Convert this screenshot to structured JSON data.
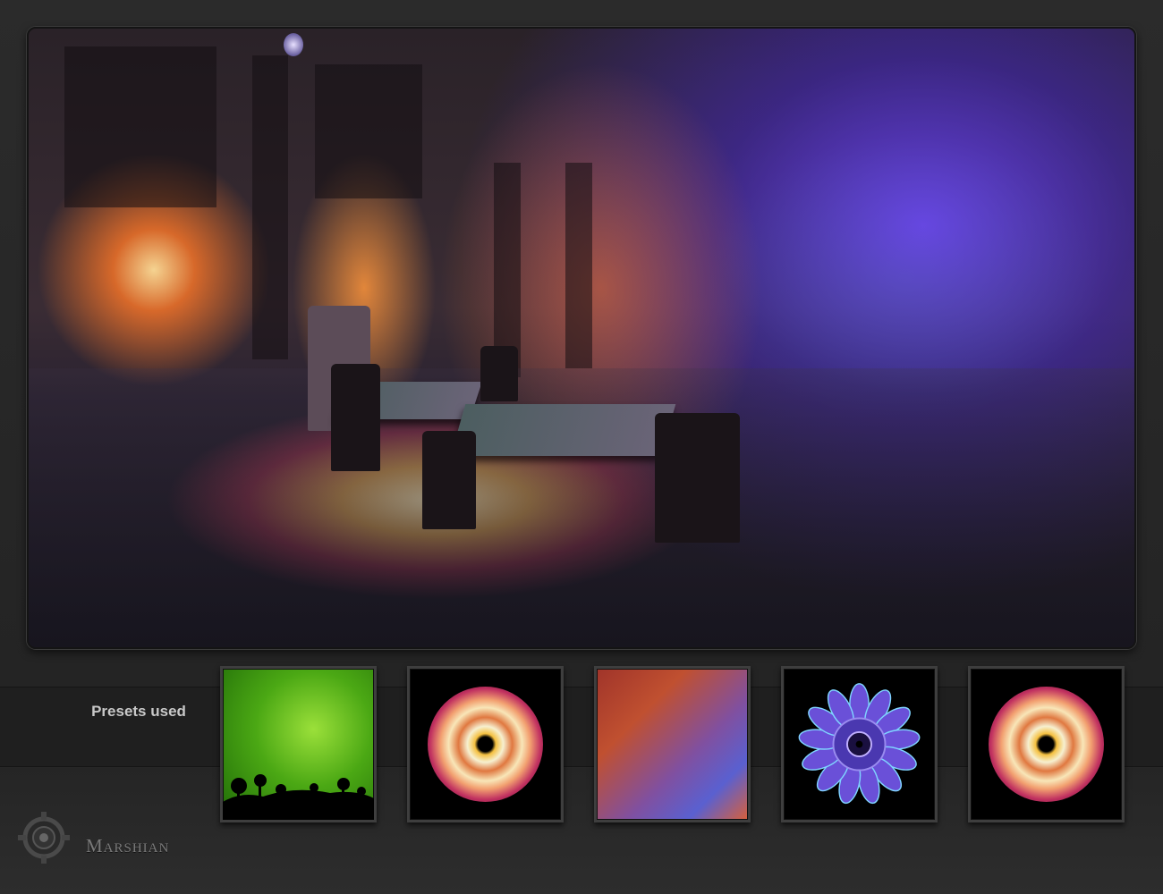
{
  "presets": {
    "label": "Presets used",
    "thumbnails": [
      {
        "name": "green-forest-silhouette"
      },
      {
        "name": "orange-radial-ring"
      },
      {
        "name": "orange-violet-gradient"
      },
      {
        "name": "blue-kaleidoscope-mandala"
      },
      {
        "name": "orange-radial-ring"
      }
    ]
  },
  "brand": {
    "name": "Marshian",
    "icon": "gear-logo-icon"
  },
  "colors": {
    "background": "#262626",
    "label_text": "#c8c8c8",
    "brand_text": "#7a7a7a"
  }
}
